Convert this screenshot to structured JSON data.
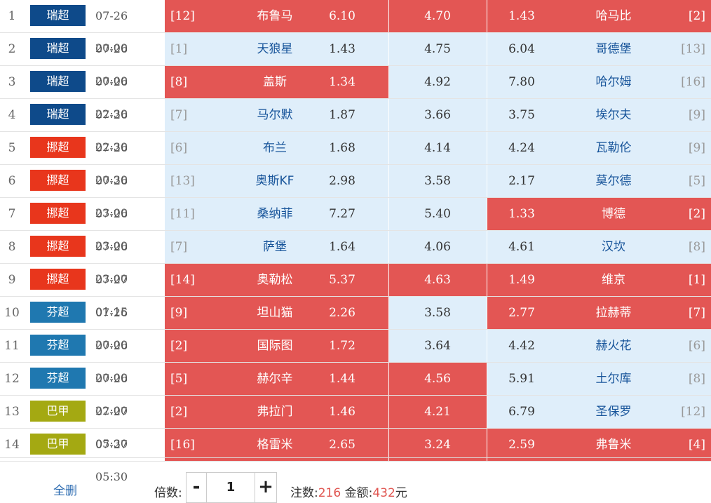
{
  "colors": {
    "selected": "#e35654",
    "unselected": "#dfeefa",
    "league_swiss": "#0e4a8a",
    "league_norway": "#e8361c",
    "league_finland": "#1f78b0",
    "league_brazil": "#a4a912"
  },
  "rows": [
    {
      "index": "1",
      "league": "瑞超",
      "league_color": "#0e4a8a",
      "time": "07-26 20:00",
      "home_rank": "[12]",
      "home": "布鲁马",
      "home_odds": "6.10",
      "draw_odds": "4.70",
      "away_odds": "1.43",
      "away": "哈马比",
      "away_rank": "[2]",
      "sel": [
        true,
        true,
        true
      ]
    },
    {
      "index": "2",
      "league": "瑞超",
      "league_color": "#0e4a8a",
      "time": "07-26 20:00",
      "home_rank": "[1]",
      "home": "天狼星",
      "home_odds": "1.43",
      "draw_odds": "4.75",
      "away_odds": "6.04",
      "away": "哥德堡",
      "away_rank": "[13]",
      "sel": [
        false,
        false,
        false
      ]
    },
    {
      "index": "3",
      "league": "瑞超",
      "league_color": "#0e4a8a",
      "time": "07-26 22:30",
      "home_rank": "[8]",
      "home": "盖斯",
      "home_odds": "1.34",
      "draw_odds": "4.92",
      "away_odds": "7.80",
      "away": "哈尔姆",
      "away_rank": "[16]",
      "sel": [
        true,
        false,
        false
      ]
    },
    {
      "index": "4",
      "league": "瑞超",
      "league_color": "#0e4a8a",
      "time": "07-26 22:30",
      "home_rank": "[7]",
      "home": "马尔默",
      "home_odds": "1.87",
      "draw_odds": "3.66",
      "away_odds": "3.75",
      "away": "埃尔夫",
      "away_rank": "[9]",
      "sel": [
        false,
        false,
        false
      ]
    },
    {
      "index": "5",
      "league": "挪超",
      "league_color": "#e8361c",
      "time": "07-26 20:30",
      "home_rank": "[6]",
      "home": "布兰",
      "home_odds": "1.68",
      "draw_odds": "4.14",
      "away_odds": "4.24",
      "away": "瓦勒伦",
      "away_rank": "[9]",
      "sel": [
        false,
        false,
        false
      ]
    },
    {
      "index": "6",
      "league": "挪超",
      "league_color": "#e8361c",
      "time": "07-26 23:00",
      "home_rank": "[13]",
      "home": "奥斯KF",
      "home_odds": "2.98",
      "draw_odds": "3.58",
      "away_odds": "2.17",
      "away": "莫尔德",
      "away_rank": "[5]",
      "sel": [
        false,
        false,
        false
      ]
    },
    {
      "index": "7",
      "league": "挪超",
      "league_color": "#e8361c",
      "time": "07-26 23:00",
      "home_rank": "[11]",
      "home": "桑纳菲",
      "home_odds": "7.27",
      "draw_odds": "5.40",
      "away_odds": "1.33",
      "away": "博德",
      "away_rank": "[2]",
      "sel": [
        false,
        false,
        true
      ]
    },
    {
      "index": "8",
      "league": "挪超",
      "league_color": "#e8361c",
      "time": "07-26 23:00",
      "home_rank": "[7]",
      "home": "萨堡",
      "home_odds": "1.64",
      "draw_odds": "4.06",
      "away_odds": "4.61",
      "away": "汉坎",
      "away_rank": "[8]",
      "sel": [
        false,
        false,
        false
      ]
    },
    {
      "index": "9",
      "league": "挪超",
      "league_color": "#e8361c",
      "time": "07-27 01:15",
      "home_rank": "[14]",
      "home": "奥勒松",
      "home_odds": "5.37",
      "draw_odds": "4.63",
      "away_odds": "1.49",
      "away": "维京",
      "away_rank": "[1]",
      "sel": [
        true,
        true,
        true
      ]
    },
    {
      "index": "10",
      "league": "芬超",
      "league_color": "#1f78b0",
      "time": "07-26 20:00",
      "home_rank": "[9]",
      "home": "坦山猫",
      "home_odds": "2.26",
      "draw_odds": "3.58",
      "away_odds": "2.77",
      "away": "拉赫蒂",
      "away_rank": "[7]",
      "sel": [
        true,
        false,
        true
      ]
    },
    {
      "index": "11",
      "league": "芬超",
      "league_color": "#1f78b0",
      "time": "07-26 20:00",
      "home_rank": "[2]",
      "home": "国际图",
      "home_odds": "1.72",
      "draw_odds": "3.64",
      "away_odds": "4.42",
      "away": "赫火花",
      "away_rank": "[6]",
      "sel": [
        true,
        false,
        false
      ]
    },
    {
      "index": "12",
      "league": "芬超",
      "league_color": "#1f78b0",
      "time": "07-26 22:00",
      "home_rank": "[5]",
      "home": "赫尔辛",
      "home_odds": "1.44",
      "draw_odds": "4.56",
      "away_odds": "5.91",
      "away": "土尔库",
      "away_rank": "[8]",
      "sel": [
        true,
        true,
        false
      ]
    },
    {
      "index": "13",
      "league": "巴甲",
      "league_color": "#a4a912",
      "time": "07-27 05:30",
      "home_rank": "[2]",
      "home": "弗拉门",
      "home_odds": "1.46",
      "draw_odds": "4.21",
      "away_odds": "6.79",
      "away": "圣保罗",
      "away_rank": "[12]",
      "sel": [
        true,
        true,
        false
      ]
    },
    {
      "index": "14",
      "league": "巴甲",
      "league_color": "#a4a912",
      "time": "07-27 05:30",
      "home_rank": "[16]",
      "home": "格雷米",
      "home_odds": "2.65",
      "draw_odds": "3.24",
      "away_odds": "2.59",
      "away": "弗鲁米",
      "away_rank": "[4]",
      "sel": [
        true,
        true,
        true
      ]
    }
  ],
  "footer": {
    "clear_label": "全删",
    "multiplier_label": "倍数:",
    "minus": "-",
    "multiplier_value": "1",
    "plus": "+",
    "bets_label": "注数:",
    "bets_value": "216",
    "amount_label": "金额:",
    "amount_value": "432",
    "amount_unit": "元"
  }
}
